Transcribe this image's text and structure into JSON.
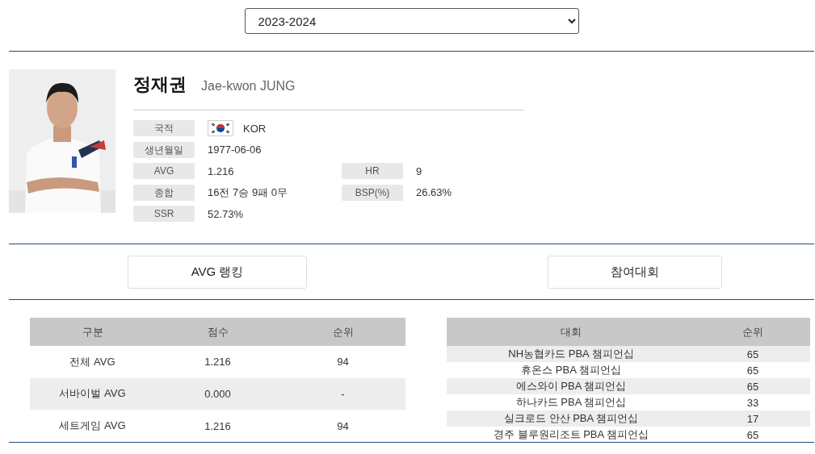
{
  "season": {
    "value": "2023-2024"
  },
  "player": {
    "name_ko": "정재권",
    "name_en": "Jae-kwon JUNG",
    "info_rows": [
      {
        "cells": [
          {
            "label": "국적",
            "value": "KOR",
            "flag": true
          }
        ]
      },
      {
        "cells": [
          {
            "label": "생년월일",
            "value": "1977-06-06"
          }
        ]
      },
      {
        "cells": [
          {
            "label": "AVG",
            "value": "1.216"
          },
          {
            "label": "HR",
            "value": "9"
          }
        ]
      },
      {
        "cells": [
          {
            "label": "종합",
            "value": "16전 7승 9패 0무"
          },
          {
            "label": "BSP(%)",
            "value": "26.63%"
          }
        ]
      },
      {
        "cells": [
          {
            "label": "SSR",
            "value": "52.73%"
          }
        ]
      }
    ]
  },
  "buttons": [
    "AVG 랭킹",
    "참여대회"
  ],
  "ranking_table": {
    "columns": [
      "구분",
      "점수",
      "순위"
    ],
    "rows": [
      [
        "전체 AVG",
        "1.216",
        "94"
      ],
      [
        "서바이벌 AVG",
        "0.000",
        "-"
      ],
      [
        "세트게임 AVG",
        "1.216",
        "94"
      ]
    ]
  },
  "tournament_table": {
    "columns": [
      "대회",
      "순위"
    ],
    "rows": [
      [
        "NH농협카드 PBA 챔피언십",
        "65"
      ],
      [
        "휴온스 PBA 챔피언십",
        "65"
      ],
      [
        "에스와이 PBA 챔피언십",
        "65"
      ],
      [
        "하나카드 PBA 챔피언십",
        "33"
      ],
      [
        "실크로드 안산 PBA 챔피언십",
        "17"
      ],
      [
        "경주 블루원리조트 PBA 챔피언십",
        "65"
      ]
    ]
  }
}
